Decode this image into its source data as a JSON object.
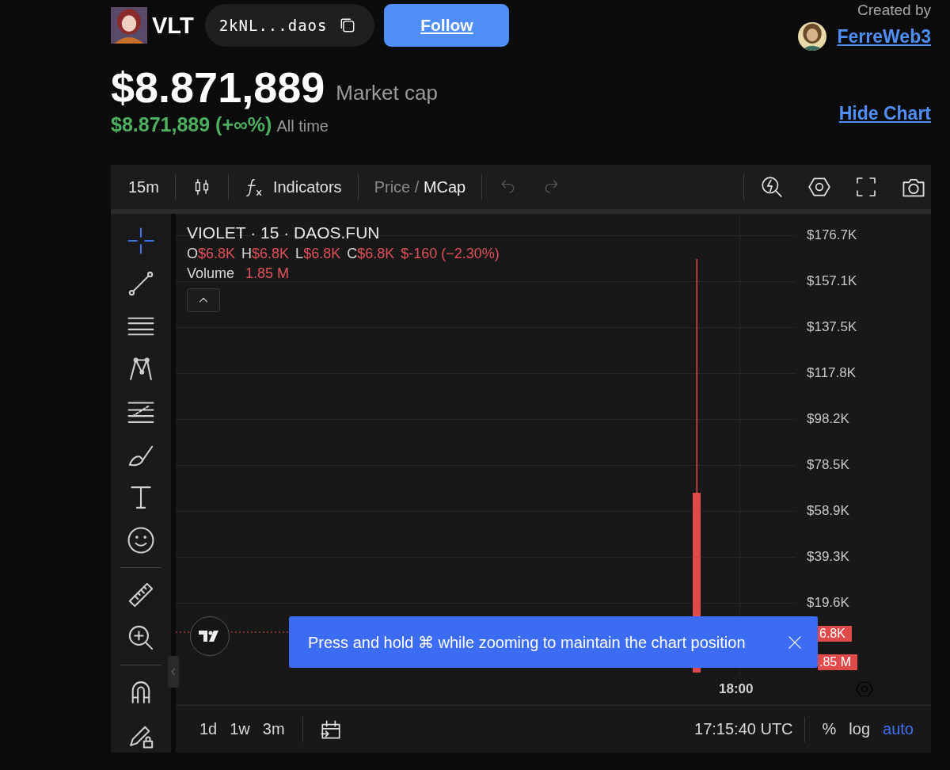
{
  "token": {
    "symbol": "VLT",
    "address": "2kNL...daos",
    "follow_button": "Follow"
  },
  "creator": {
    "label": "Created by",
    "name": "FerreWeb3"
  },
  "market_cap": {
    "value": "$8.871,889",
    "label": "Market cap",
    "change": "$8.871,889 (+∞%)",
    "period": "All time"
  },
  "hide_chart": "Hide Chart",
  "toolbar": {
    "interval": "15m",
    "indicators": "Indicators",
    "modes": [
      {
        "label": "Price",
        "selected": false
      },
      {
        "label": "MCap",
        "selected": true
      }
    ],
    "separator": "/",
    "undo_disabled": true,
    "redo_disabled": true
  },
  "tools": [
    {
      "kind": "crosshair",
      "selected": true
    },
    {
      "kind": "trend-line",
      "selected": false
    },
    {
      "kind": "horizontal-lines",
      "selected": false
    },
    {
      "kind": "pattern",
      "selected": false
    },
    {
      "kind": "fib",
      "selected": false
    },
    {
      "kind": "brush",
      "selected": false
    },
    {
      "kind": "text",
      "selected": false
    },
    {
      "kind": "emoji",
      "selected": false
    },
    {
      "kind": "divider"
    },
    {
      "kind": "ruler",
      "selected": false
    },
    {
      "kind": "zoom",
      "selected": false
    },
    {
      "kind": "divider"
    },
    {
      "kind": "magnet",
      "selected": false
    },
    {
      "kind": "lock",
      "selected": false
    }
  ],
  "legend": {
    "title": "VIOLET · 15 · DAOS.FUN",
    "ohlc": [
      {
        "key": "O",
        "value": "$6.8K"
      },
      {
        "key": "H",
        "value": "$6.8K"
      },
      {
        "key": "L",
        "value": "$6.8K"
      },
      {
        "key": "C",
        "value": "$6.8K"
      }
    ],
    "change": "$-160 (−2.30%)",
    "volume_label": "Volume",
    "volume_value": "1.85 M"
  },
  "price_axis": [
    "$176.7K",
    "$157.1K",
    "$137.5K",
    "$117.8K",
    "$98.2K",
    "$78.5K",
    "$58.9K",
    "$39.3K",
    "$19.6K"
  ],
  "price_tags": [
    "6.8K",
    ".85 M"
  ],
  "time_axis": [
    "18:00"
  ],
  "toast": {
    "message": "Press and hold ⌘ while zooming to maintain the chart position"
  },
  "ranges": [
    "1d",
    "1w",
    "3m"
  ],
  "clock": "17:15:40 UTC",
  "scales": [
    {
      "label": "%",
      "selected": false
    },
    {
      "label": "log",
      "selected": false
    },
    {
      "label": "auto",
      "selected": true
    }
  ]
}
